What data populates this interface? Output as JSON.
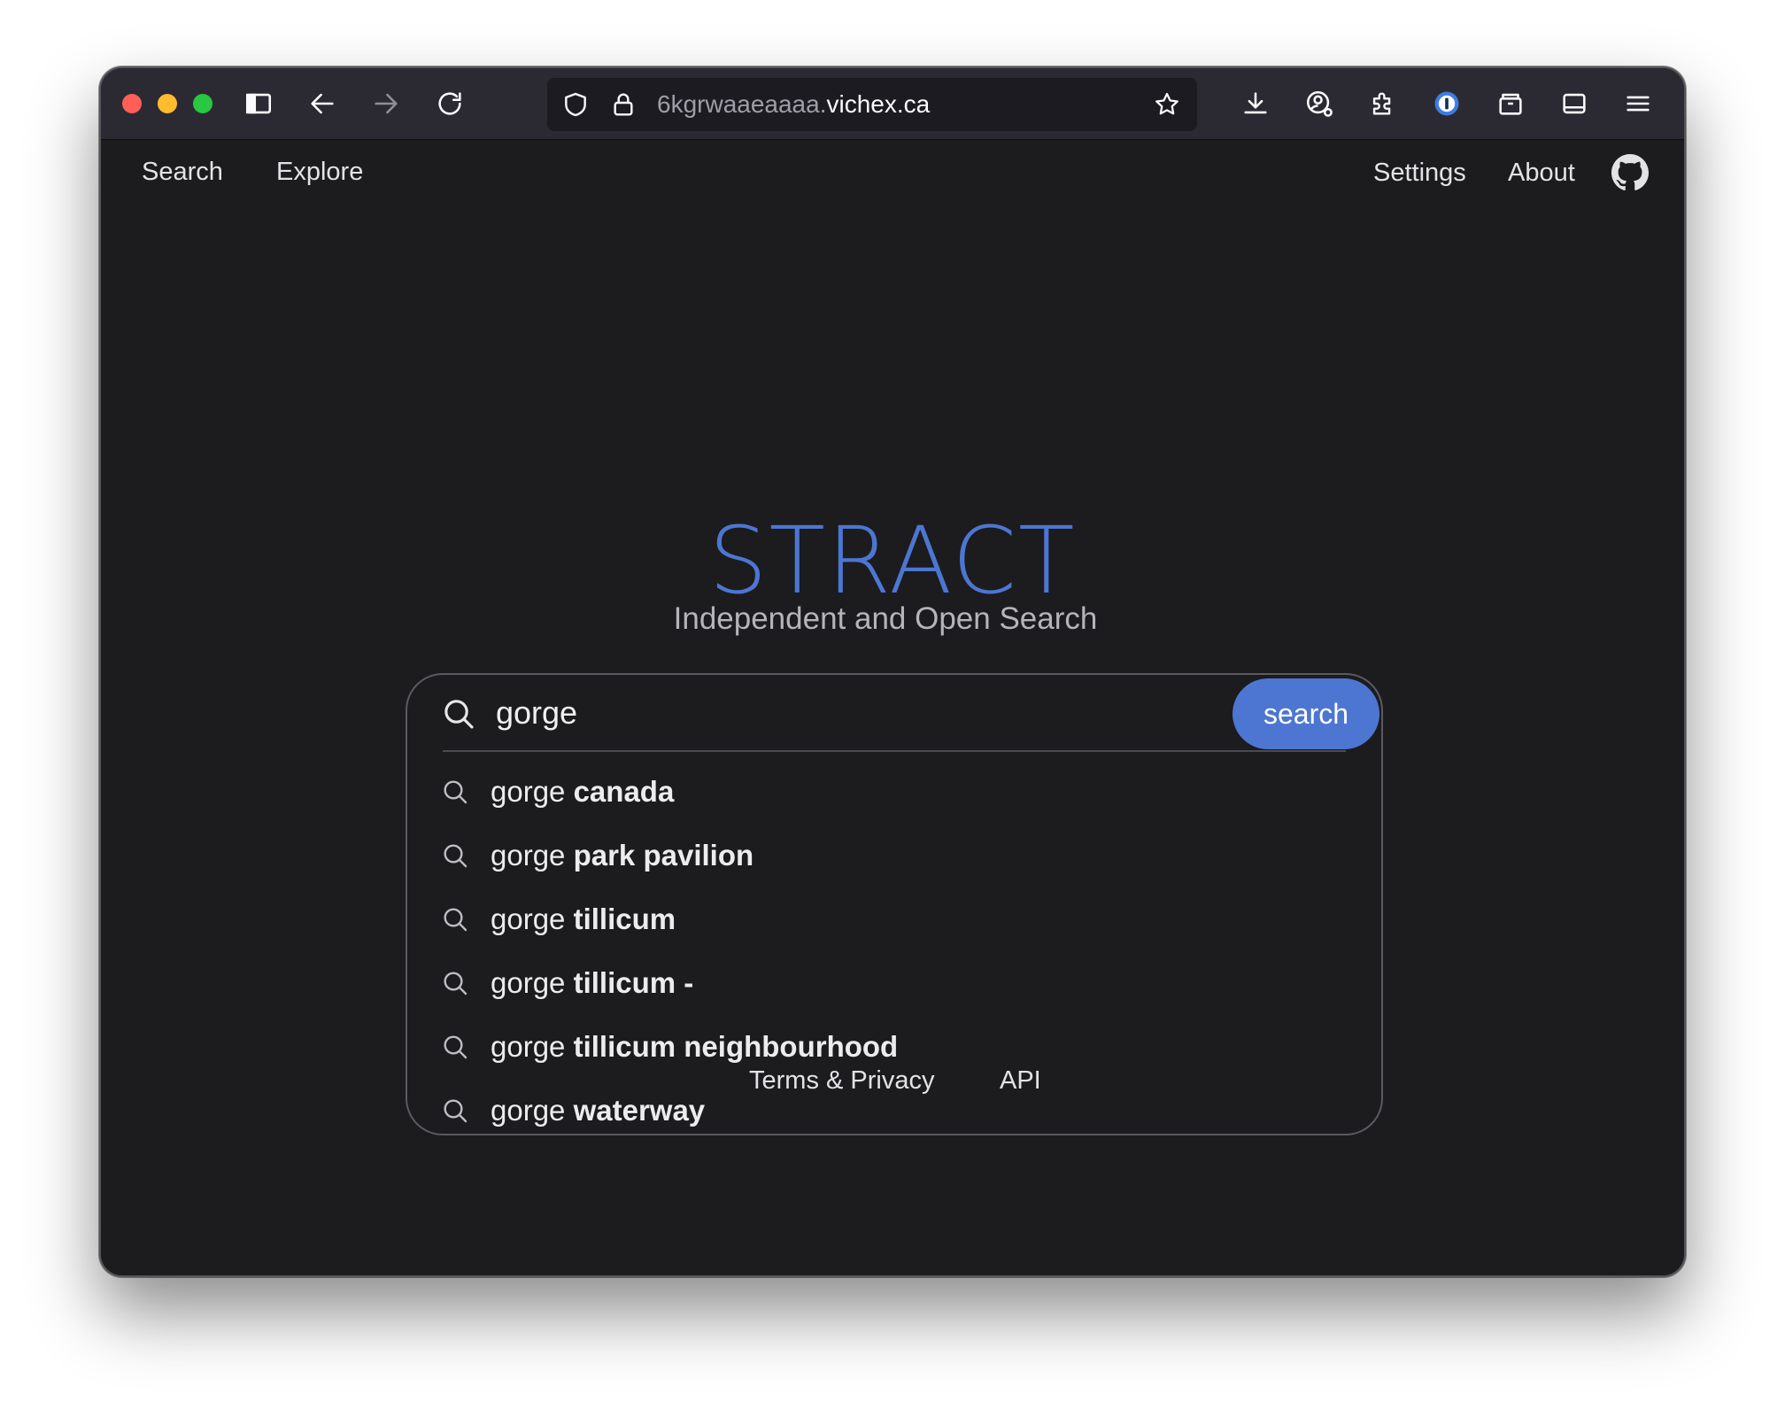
{
  "browser": {
    "url_subdomain": "6kgrwaaeaaaa.",
    "url_domain": "vichex.ca",
    "toolbar_icons": [
      "sidebar-icon",
      "back-arrow-icon",
      "forward-arrow-icon",
      "reload-icon",
      "shield-icon",
      "lock-icon",
      "bookmark-star-icon",
      "download-icon",
      "account-icon",
      "extensions-icon",
      "password-manager-icon",
      "tab-container-icon",
      "reader-view-icon",
      "menu-icon"
    ]
  },
  "nav": {
    "left": [
      {
        "label": "Search"
      },
      {
        "label": "Explore"
      }
    ],
    "right": [
      {
        "label": "Settings"
      },
      {
        "label": "About"
      }
    ],
    "github_icon": "github-icon"
  },
  "hero": {
    "logo": "STRACT",
    "tagline": "Independent and Open Search"
  },
  "search": {
    "value": "gorge",
    "button_label": "search",
    "accent_color": "#4c76d1",
    "suggestions": [
      {
        "prefix": "gorge",
        "rest": " canada"
      },
      {
        "prefix": "gorge",
        "rest": " park pavilion"
      },
      {
        "prefix": "gorge",
        "rest": " tillicum"
      },
      {
        "prefix": "gorge",
        "rest": " tillicum -"
      },
      {
        "prefix": "gorge",
        "rest": " tillicum neighbourhood"
      },
      {
        "prefix": "gorge",
        "rest": " waterway"
      }
    ]
  },
  "footer": {
    "links": [
      {
        "label": "Terms & Privacy"
      },
      {
        "label": "API"
      }
    ]
  }
}
